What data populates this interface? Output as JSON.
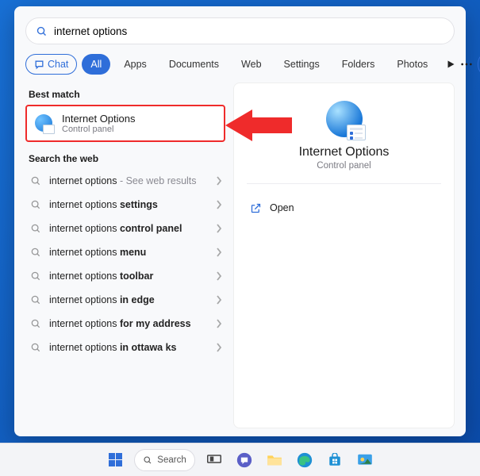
{
  "search": {
    "value": "internet options"
  },
  "filters": {
    "chat": "Chat",
    "all": "All",
    "apps": "Apps",
    "documents": "Documents",
    "web": "Web",
    "settings": "Settings",
    "folders": "Folders",
    "photos": "Photos"
  },
  "bestMatch": {
    "heading": "Best match",
    "title": "Internet Options",
    "subtitle": "Control panel"
  },
  "webSearch": {
    "heading": "Search the web",
    "items": [
      {
        "prefix": "internet options",
        "bold": "",
        "hint": " - See web results"
      },
      {
        "prefix": "internet options ",
        "bold": "settings",
        "hint": ""
      },
      {
        "prefix": "internet options ",
        "bold": "control panel",
        "hint": ""
      },
      {
        "prefix": "internet options ",
        "bold": "menu",
        "hint": ""
      },
      {
        "prefix": "internet options ",
        "bold": "toolbar",
        "hint": ""
      },
      {
        "prefix": "internet options ",
        "bold": "in edge",
        "hint": ""
      },
      {
        "prefix": "internet options ",
        "bold": "for my address",
        "hint": ""
      },
      {
        "prefix": "internet options ",
        "bold": "in ottawa ks",
        "hint": ""
      }
    ]
  },
  "preview": {
    "title": "Internet Options",
    "subtitle": "Control panel",
    "open": "Open"
  },
  "taskbar": {
    "search": "Search"
  }
}
